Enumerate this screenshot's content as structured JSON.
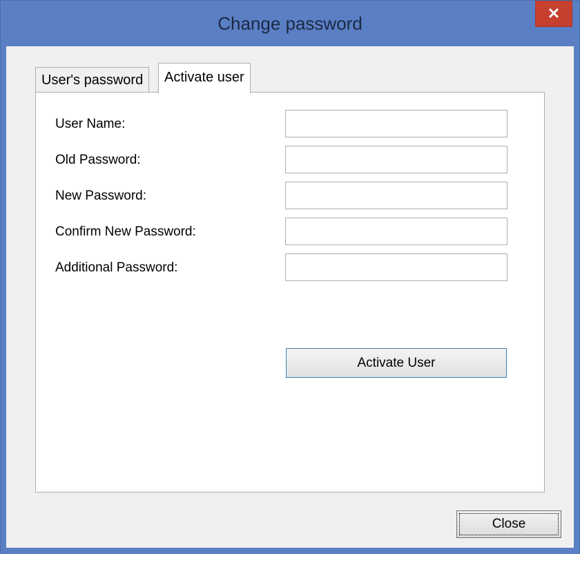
{
  "window": {
    "title": "Change password",
    "close_glyph": "✕"
  },
  "tabs": [
    {
      "label": "User's password",
      "active": false
    },
    {
      "label": "Activate user",
      "active": true
    }
  ],
  "form": {
    "fields": [
      {
        "label": "User Name:",
        "value": ""
      },
      {
        "label": "Old Password:",
        "value": ""
      },
      {
        "label": "New Password:",
        "value": ""
      },
      {
        "label": "Confirm New Password:",
        "value": ""
      },
      {
        "label": "Additional Password:",
        "value": ""
      }
    ],
    "activate_label": "Activate User"
  },
  "footer": {
    "close_label": "Close"
  },
  "colors": {
    "title_bar": "#5b7fc4",
    "close_button": "#c7402f",
    "activate_border": "#3c7fb1"
  }
}
